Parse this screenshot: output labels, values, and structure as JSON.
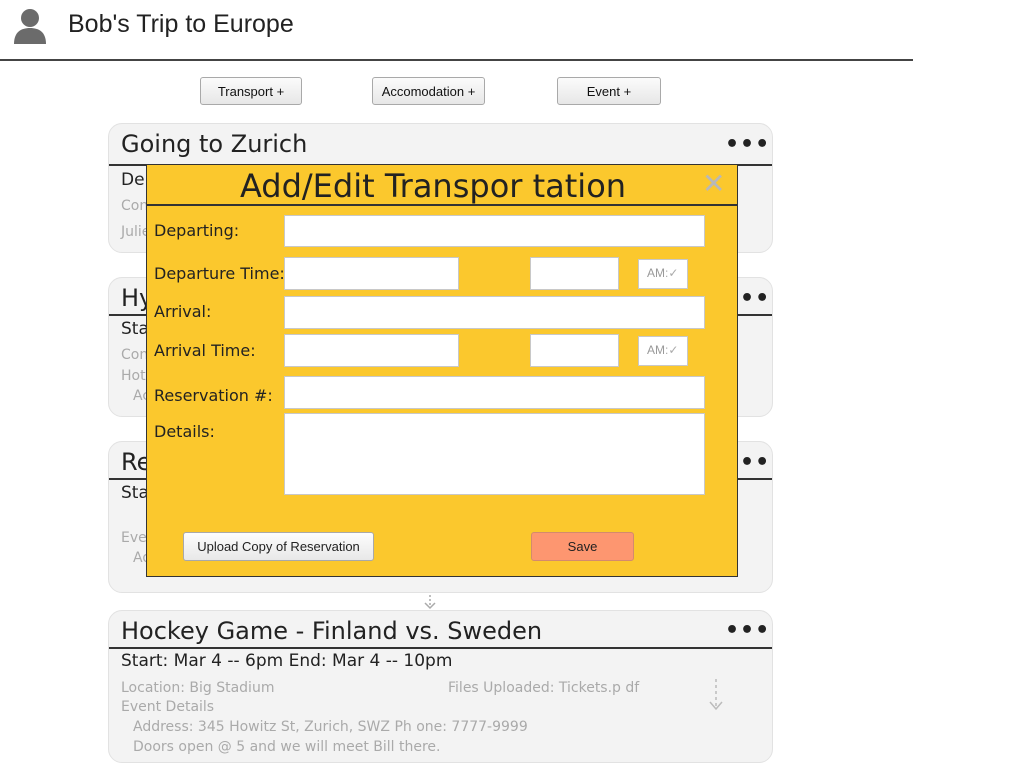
{
  "header": {
    "title": "Bob's Trip to Europe"
  },
  "toolbar": {
    "transport_label": "Transport +",
    "accommodation_label": "Accomodation +",
    "event_label": "Event +"
  },
  "cards": {
    "c1": {
      "title": "Going to Zurich",
      "line1": "Dep",
      "line2": "Con",
      "line3": "Julie"
    },
    "c2": {
      "title": "Hy",
      "line1": "Sta",
      "line2": "Con",
      "line3": "Hote",
      "line4": "Ac"
    },
    "c3": {
      "title": "Re",
      "line1": "Sta",
      "line2": "Even",
      "line3": "Ad"
    },
    "c4": {
      "title": "Hockey Game - Finland vs. Sweden",
      "start_end": "Start: Mar  4 -- 6pm   End:  Mar 4 -- 10pm",
      "location": "Location: Big Stadium",
      "files": "Files Uploaded: Tickets.p df",
      "event_details": "Event Details",
      "address": "Address:     345 Howitz St, Zurich, SWZ Ph  one: 7777-9999",
      "doors": "Doors open @       5 and we will meet Bill there."
    },
    "more_glyph": "•••"
  },
  "modal": {
    "title": "Add/Edit Transpor tation",
    "close_glyph": "✕",
    "departing_label": "Departing:",
    "departure_time_label": "Departure Time:",
    "arrival_label": "Arrival:",
    "arrival_time_label": "Arrival Time:",
    "reservation_label": "Reservation #:",
    "details_label": "Details:",
    "ampm_value": "AM",
    "upload_label": "Upload Copy of Reservation",
    "save_label": "Save",
    "departing_value": "",
    "departure_time_value": "",
    "departure_minute_value": "",
    "arrival_value": "",
    "arrival_time_value": "",
    "arrival_minute_value": "",
    "reservation_value": "",
    "details_value": ""
  },
  "icons": {
    "avatar": "user-avatar-icon",
    "more": "more-dots-icon",
    "close": "close-icon",
    "connector": "down-arrow-icon",
    "dropdown": "dropdown-check-icon"
  },
  "colors": {
    "modal_bg": "#fbc82d",
    "save_bg": "#fd9670",
    "card_bg": "#f3f3f3"
  }
}
